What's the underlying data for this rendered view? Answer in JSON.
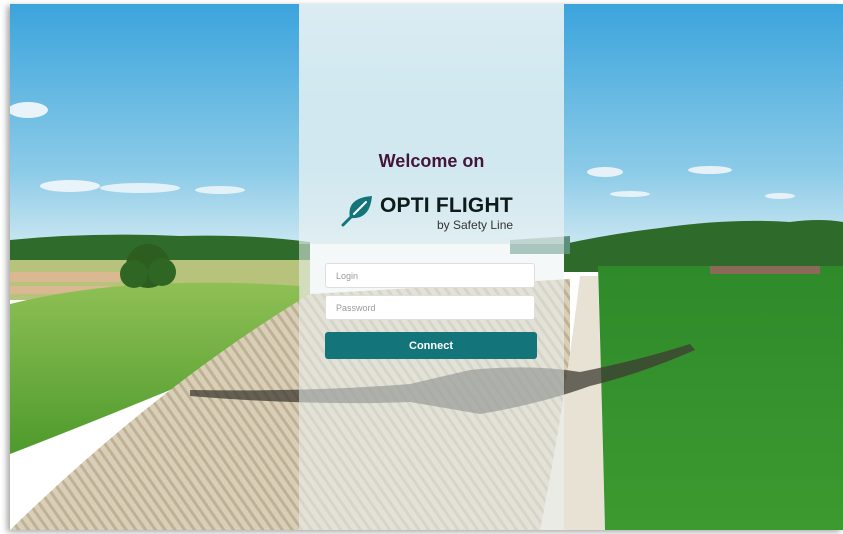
{
  "welcome": {
    "title": "Welcome on"
  },
  "logo": {
    "icon": "leaf-icon",
    "name": "OPTI FLIGHT",
    "tagline": "by Safety Line",
    "brand_color": "#137479"
  },
  "form": {
    "login_placeholder": "Login",
    "password_placeholder": "Password",
    "connect_label": "Connect"
  },
  "colors": {
    "title": "#44153a",
    "button": "#137479",
    "field_green": "#3a8a2a",
    "sky": "#64b6e0"
  }
}
